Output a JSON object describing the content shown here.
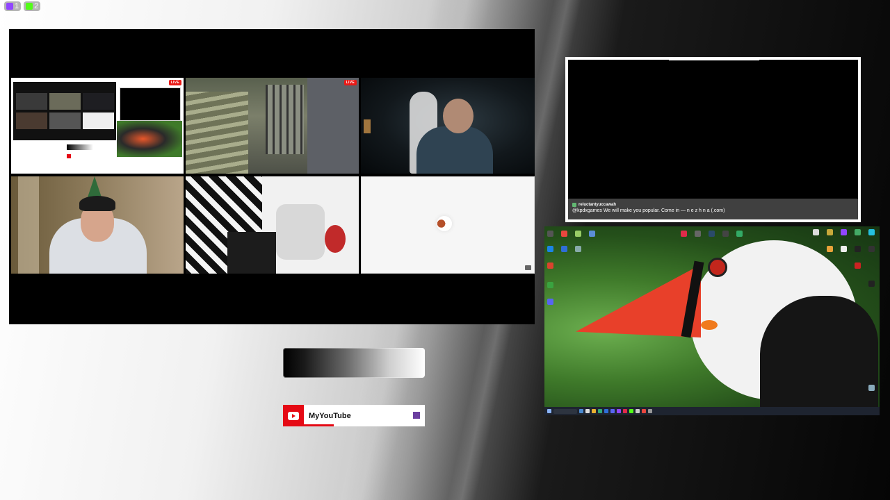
{
  "counters": [
    {
      "icon": "twitch-icon",
      "value": "1",
      "color": "#9146ff"
    },
    {
      "icon": "kick-icon",
      "value": "2",
      "color": "#53fc18"
    }
  ],
  "grid": {
    "live_label": "LIVE"
  },
  "chat": {
    "username": "reluctantyuccawah",
    "message": "@kpdxgames We will make you popular. Come in — n e z h n a (.com)"
  },
  "social": {
    "youtube_label": "MyYouTube",
    "accent": "#e50914"
  }
}
